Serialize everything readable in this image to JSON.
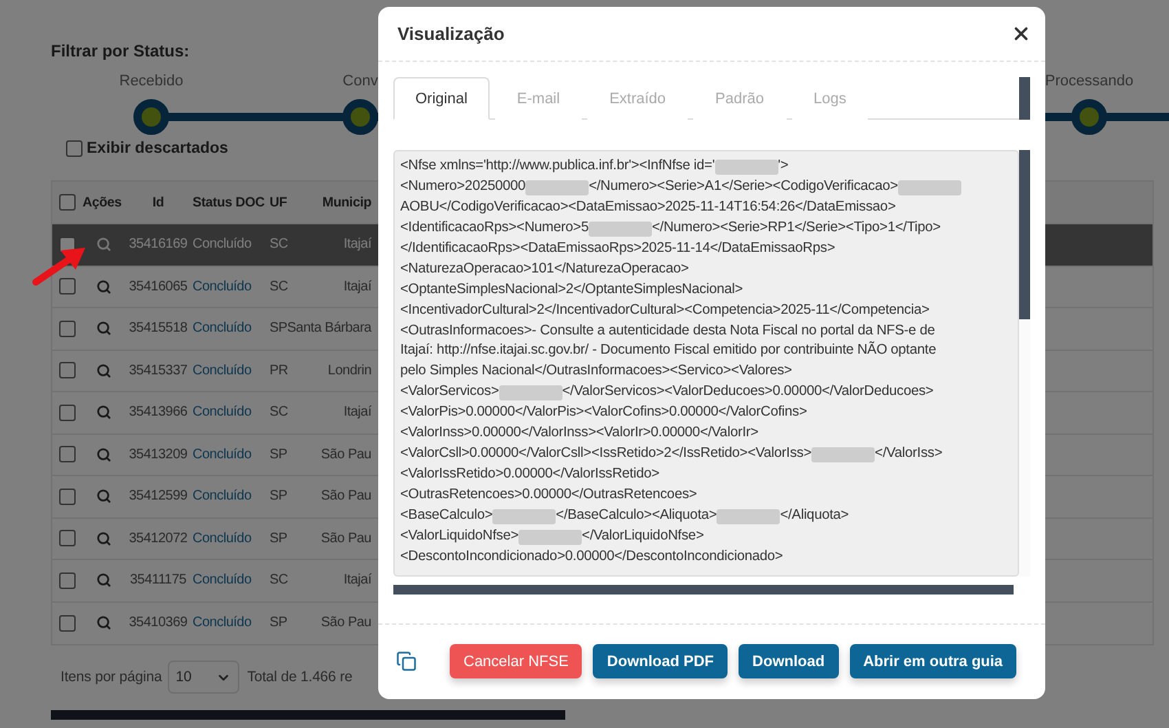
{
  "page": {
    "filter_title": "Filtrar por Status:",
    "status_steps": [
      {
        "label": "Recebido"
      },
      {
        "label": "Conv"
      },
      {
        "label": "Processando"
      }
    ],
    "show_discarded": {
      "label": "Exibir descartados",
      "checked": false
    },
    "table": {
      "select_all": {
        "checked": false
      },
      "columns": [
        "Ações",
        "Id",
        "Status DOC",
        "UF",
        "Municip"
      ],
      "rows": [
        {
          "id": "35416169",
          "status": "Concluído",
          "uf": "SC",
          "municipio": "Itajaí",
          "checked": false,
          "selected": true
        },
        {
          "id": "35416065",
          "status": "Concluído",
          "uf": "SC",
          "municipio": "Itajaí",
          "checked": false,
          "selected": false
        },
        {
          "id": "35415518",
          "status": "Concluído",
          "uf": "SP",
          "municipio": "Santa Bárbara",
          "checked": false,
          "selected": false
        },
        {
          "id": "35415337",
          "status": "Concluído",
          "uf": "PR",
          "municipio": "Londrin",
          "checked": false,
          "selected": false
        },
        {
          "id": "35413966",
          "status": "Concluído",
          "uf": "SC",
          "municipio": "Itajaí",
          "checked": false,
          "selected": false
        },
        {
          "id": "35413209",
          "status": "Concluído",
          "uf": "SP",
          "municipio": "São Pau",
          "checked": false,
          "selected": false
        },
        {
          "id": "35412599",
          "status": "Concluído",
          "uf": "SP",
          "municipio": "São Pau",
          "checked": false,
          "selected": false
        },
        {
          "id": "35412072",
          "status": "Concluído",
          "uf": "SP",
          "municipio": "São Pau",
          "checked": false,
          "selected": false
        },
        {
          "id": "35411175",
          "status": "Concluído",
          "uf": "SC",
          "municipio": "Itajaí",
          "checked": false,
          "selected": false
        },
        {
          "id": "35410369",
          "status": "Concluído",
          "uf": "SP",
          "municipio": "São Pau",
          "checked": false,
          "selected": false
        }
      ]
    },
    "pagination": {
      "label": "Itens por página",
      "page_size": "10",
      "total": "Total de 1.466 re"
    }
  },
  "modal": {
    "title": "Visualização",
    "tabs": [
      {
        "label": "Original",
        "selected": true
      },
      {
        "label": "E-mail",
        "selected": false
      },
      {
        "label": "Extraído",
        "selected": false
      },
      {
        "label": "Padrão",
        "selected": false
      },
      {
        "label": "Logs",
        "selected": false
      }
    ],
    "xml_lines": [
      [
        {
          "kind": "text",
          "text": "<Nfse xmlns='http://www.publica.inf.br'><InfNfse id='"
        },
        {
          "kind": "redacted"
        },
        {
          "kind": "text",
          "text": "'>"
        }
      ],
      [
        {
          "kind": "text",
          "text": "<Numero>20250000"
        },
        {
          "kind": "redacted"
        },
        {
          "kind": "text",
          "text": "</Numero><Serie>A1</Serie><CodigoVerificacao>"
        },
        {
          "kind": "redacted"
        }
      ],
      [
        {
          "kind": "text",
          "text": "AOBU</CodigoVerificacao><DataEmissao>2025-11-14T16:54:26</DataEmissao>"
        }
      ],
      [
        {
          "kind": "text",
          "text": "<IdentificacaoRps><Numero>5"
        },
        {
          "kind": "redacted"
        },
        {
          "kind": "text",
          "text": "</Numero><Serie>RP1</Serie><Tipo>1</Tipo>"
        }
      ],
      [
        {
          "kind": "text",
          "text": "</IdentificacaoRps><DataEmissaoRps>2025-11-14</DataEmissaoRps>"
        }
      ],
      [
        {
          "kind": "text",
          "text": "<NaturezaOperacao>101</NaturezaOperacao>"
        }
      ],
      [
        {
          "kind": "text",
          "text": "<OptanteSimplesNacional>2</OptanteSimplesNacional>"
        }
      ],
      [
        {
          "kind": "text",
          "text": "<IncentivadorCultural>2</IncentivadorCultural><Competencia>2025-11</Competencia>"
        }
      ],
      [
        {
          "kind": "text",
          "text": "<OutrasInformacoes>- Consulte a autenticidade desta Nota Fiscal no portal da NFS-e de"
        }
      ],
      [
        {
          "kind": "text",
          "text": "Itajaí: http://nfse.itajai.sc.gov.br/ - Documento Fiscal emitido por contribuinte NÃO optante"
        }
      ],
      [
        {
          "kind": "text",
          "text": "pelo Simples Nacional</OutrasInformacoes><Servico><Valores>"
        }
      ],
      [
        {
          "kind": "text",
          "text": "<ValorServicos>"
        },
        {
          "kind": "redacted"
        },
        {
          "kind": "text",
          "text": "</ValorServicos><ValorDeducoes>0.00000</ValorDeducoes>"
        }
      ],
      [
        {
          "kind": "text",
          "text": "<ValorPis>0.00000</ValorPis><ValorCofins>0.00000</ValorCofins>"
        }
      ],
      [
        {
          "kind": "text",
          "text": "<ValorInss>0.00000</ValorInss><ValorIr>0.00000</ValorIr>"
        }
      ],
      [
        {
          "kind": "text",
          "text": "<ValorCsll>0.00000</ValorCsll><IssRetido>2</IssRetido><ValorIss>"
        },
        {
          "kind": "redacted"
        },
        {
          "kind": "text",
          "text": "</ValorIss>"
        }
      ],
      [
        {
          "kind": "text",
          "text": "<ValorIssRetido>0.00000</ValorIssRetido>"
        }
      ],
      [
        {
          "kind": "text",
          "text": "<OutrasRetencoes>0.00000</OutrasRetencoes>"
        }
      ],
      [
        {
          "kind": "text",
          "text": "<BaseCalculo>"
        },
        {
          "kind": "redacted"
        },
        {
          "kind": "text",
          "text": "</BaseCalculo><Aliquota>"
        },
        {
          "kind": "redacted"
        },
        {
          "kind": "text",
          "text": "</Aliquota>"
        }
      ],
      [
        {
          "kind": "text",
          "text": "<ValorLiquidoNfse>"
        },
        {
          "kind": "redacted"
        },
        {
          "kind": "text",
          "text": "</ValorLiquidoNfse>"
        }
      ],
      [
        {
          "kind": "text",
          "text": "<DescontoIncondicionado>0.00000</DescontoIncondicionado>"
        }
      ]
    ],
    "buttons": [
      {
        "label": "Cancelar NFSE",
        "kind": "danger"
      },
      {
        "label": "Download PDF",
        "kind": "primary"
      },
      {
        "label": "Download",
        "kind": "primary"
      },
      {
        "label": "Abrir em outra guia",
        "kind": "primary"
      }
    ]
  }
}
